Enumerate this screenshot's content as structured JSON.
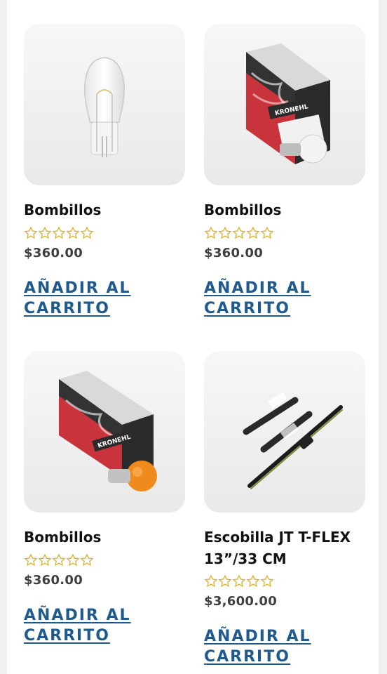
{
  "products": [
    {
      "title": "Bombillos",
      "price": "$360.00",
      "cta_line1": "AÑADIR AL",
      "cta_line2": "CARRITO",
      "image": "clear-bulb"
    },
    {
      "title": "Bombillos",
      "price": "$360.00",
      "cta_line1": "AÑADIR AL",
      "cta_line2": "CARRITO",
      "image": "kronehl-box-clear-bulb",
      "brand": "KRONEHL"
    },
    {
      "title": "Bombillos",
      "price": "$360.00",
      "cta_line1": "AÑADIR AL",
      "cta_line2": "CARRITO",
      "image": "kronehl-box-amber-bulb",
      "brand": "KRONEHL"
    },
    {
      "title_line1": "Escobilla JT T-FLEX",
      "title_line2": "13”/33 CM",
      "price": "$3,600.00",
      "cta_line1": "AÑADIR AL",
      "cta_line2": "CARRITO",
      "image": "wiper-blade"
    }
  ],
  "rating": {
    "stars_filled": 0,
    "stars_total": 5,
    "star_color": "#d6b52e"
  },
  "colors": {
    "cta": "#1f5a8e",
    "price": "#3f3f3f",
    "title": "#111111"
  }
}
